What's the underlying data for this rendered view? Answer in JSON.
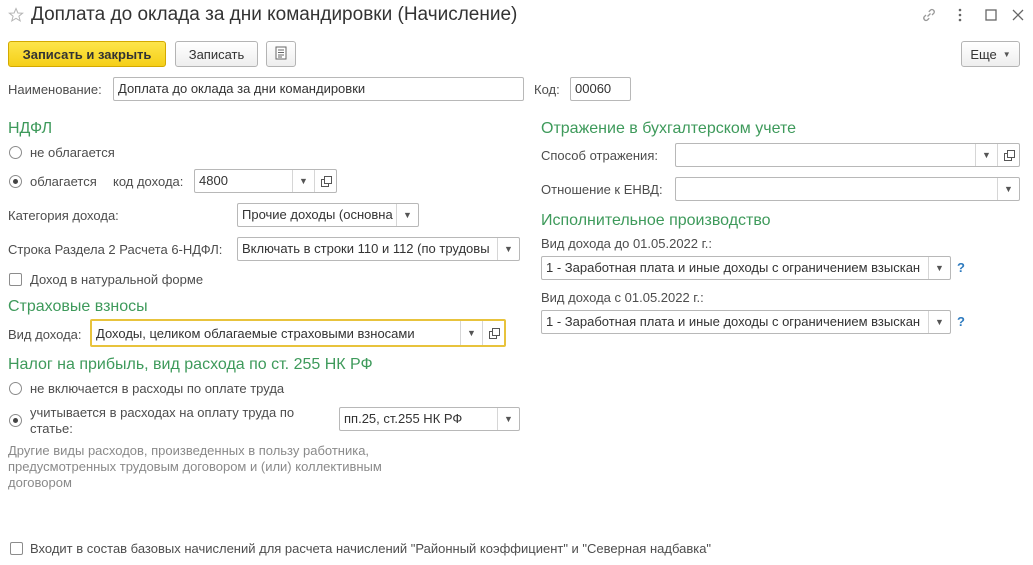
{
  "window": {
    "title": "Доплата до оклада за дни командировки (Начисление)"
  },
  "toolbar": {
    "save_close": "Записать и закрыть",
    "save": "Записать",
    "more": "Еще"
  },
  "header": {
    "name_label": "Наименование:",
    "name_value": "Доплата до оклада за дни командировки",
    "code_label": "Код:",
    "code_value": "00060"
  },
  "ndfl": {
    "title": "НДФЛ",
    "not_taxed": "не облагается",
    "taxed": "облагается",
    "income_code_label": "код дохода:",
    "income_code_value": "4800",
    "category_label": "Категория дохода:",
    "category_value": "Прочие доходы (основна",
    "line_label": "Строка Раздела 2 Расчета 6-НДФЛ:",
    "line_value": "Включать в строки 110 и 112 (по трудовы",
    "in_kind": "Доход в натуральной форме"
  },
  "insurance": {
    "title": "Страховые взносы",
    "income_type_label": "Вид дохода:",
    "income_type_value": "Доходы, целиком облагаемые страховыми взносами"
  },
  "profit_tax": {
    "title": "Налог на прибыль, вид расхода по ст. 255 НК РФ",
    "not_included": "не включается в расходы по оплате труда",
    "included_line1": "учитывается в расходах на оплату труда по",
    "included_line2": "статье:",
    "article_value": "пп.25, ст.255 НК РФ",
    "hint": "Другие виды расходов, произведенных в пользу работника, предусмотренных трудовым договором и (или) коллективным договором"
  },
  "accounting": {
    "title": "Отражение в бухгалтерском учете",
    "method_label": "Способ отражения:",
    "method_value": "",
    "envd_label": "Отношение к ЕНВД:",
    "envd_value": ""
  },
  "enforcement": {
    "title": "Исполнительное производство",
    "before_label": "Вид дохода до 01.05.2022 г.:",
    "before_value": "1 - Заработная плата и иные доходы с ограничением взыскан",
    "after_label": "Вид дохода с 01.05.2022 г.:",
    "after_value": "1 - Заработная плата и иные доходы с ограничением взыскан",
    "help": "?"
  },
  "footer": {
    "base_check": "Входит в состав базовых начислений для расчета начислений \"Районный коэффициент\" и \"Северная надбавка\""
  }
}
